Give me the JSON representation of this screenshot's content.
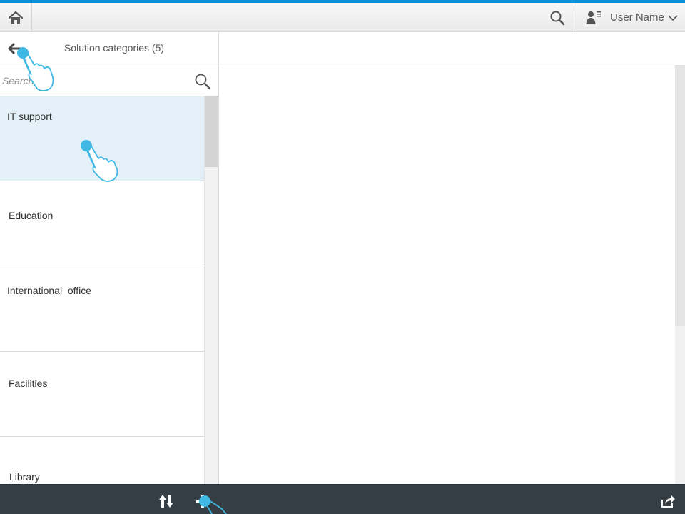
{
  "colors": {
    "accent": "#0a8fd8",
    "selected_bg": "#e3f0f8",
    "footer_bg": "#353e45",
    "gesture": "#3fb8e4"
  },
  "shell": {
    "home_icon": "home-icon",
    "search_icon": "search-icon",
    "user_icon": "user-icon",
    "user_name": "User Name",
    "user_menu_icon": "chevron-down-icon"
  },
  "master": {
    "back_icon": "arrow-left-icon",
    "title": "Solution categories (5)",
    "search": {
      "placeholder": "Search",
      "icon": "search-icon"
    },
    "items": [
      {
        "label": "IT support",
        "selected": true
      },
      {
        "label": "Education",
        "selected": false
      },
      {
        "label": "International  office",
        "selected": false
      },
      {
        "label": "Facilities",
        "selected": false
      },
      {
        "label": "Library",
        "selected": false
      }
    ]
  },
  "footer": {
    "sort_icon": "sort-icon",
    "add_icon": "add-icon",
    "share_icon": "share-icon"
  },
  "gestures": [
    {
      "name": "tap-hint-back",
      "icon": "hand-pointer-icon"
    },
    {
      "name": "tap-hint-item",
      "icon": "hand-pointer-icon"
    },
    {
      "name": "tap-hint-add",
      "icon": "hand-pointer-icon"
    }
  ]
}
